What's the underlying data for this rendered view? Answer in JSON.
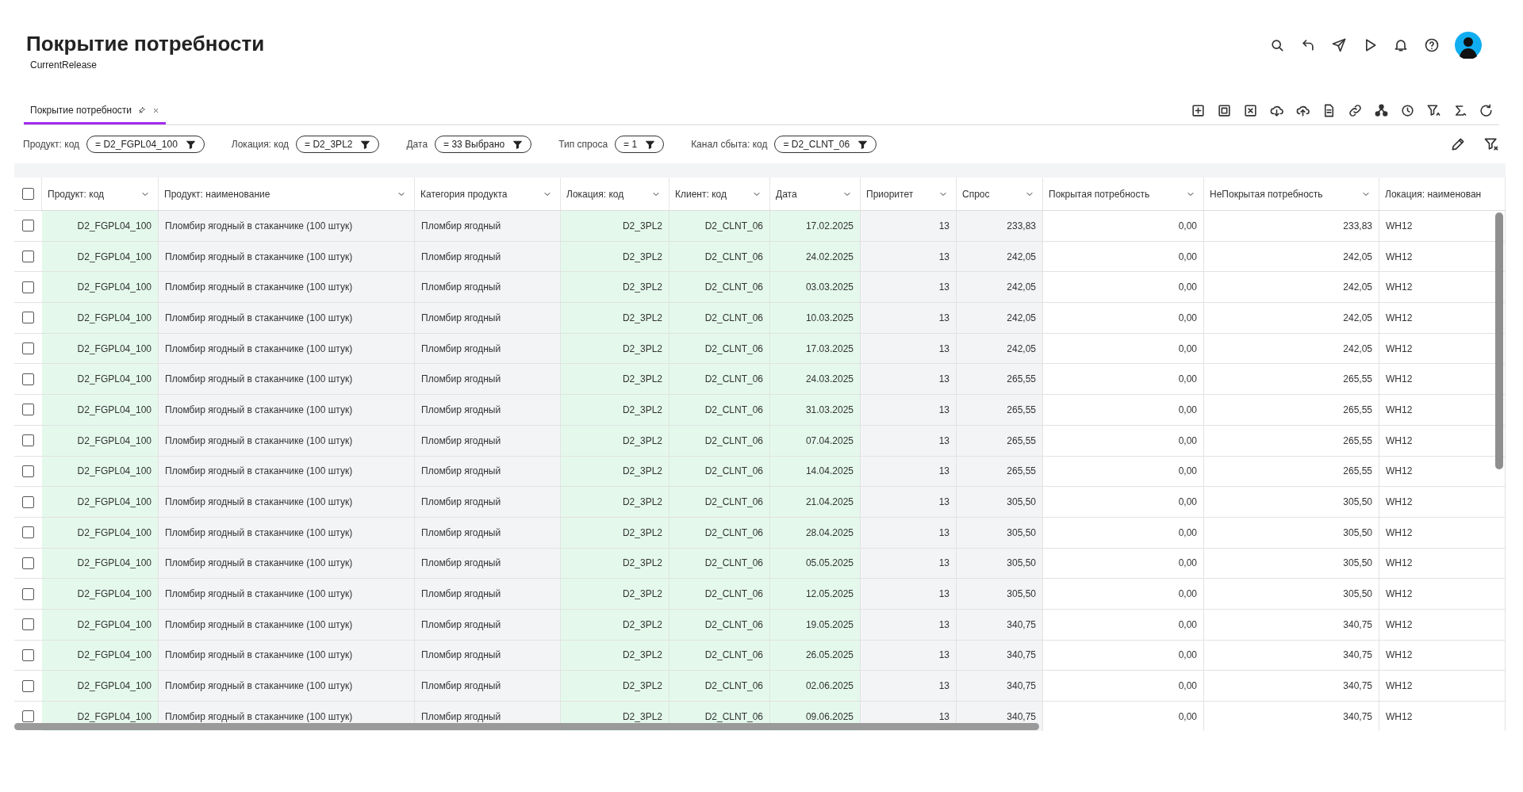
{
  "page": {
    "title": "Покрытие потребности",
    "subtitle": "CurrentRelease"
  },
  "tabs": [
    {
      "label": "Покрытие потребности",
      "selected": true
    }
  ],
  "filters": [
    {
      "label": "Продукт: код",
      "value": "= D2_FGPL04_100"
    },
    {
      "label": "Локация: код",
      "value": "= D2_3PL2"
    },
    {
      "label": "Дата",
      "value": "= 33 Выбрано"
    },
    {
      "label": "Тип спроса",
      "value": "= 1"
    },
    {
      "label": "Канал сбыта: код",
      "value": "= D2_CLNT_06"
    }
  ],
  "table": {
    "header_checked": false,
    "columns": [
      "Продукт: код",
      "Продукт: наименование",
      "Категория продукта",
      "Локация: код",
      "Клиент: код",
      "Дата",
      "Приоритет",
      "Спрос",
      "Покрытая потребность",
      "НеПокрытая потребность",
      "Локация: наименован"
    ],
    "rows": [
      {
        "checked": false,
        "cells": [
          "D2_FGPL04_100",
          "Пломбир ягодный в стаканчике (100 штук)",
          "Пломбир ягодный",
          "D2_3PL2",
          "D2_CLNT_06",
          "17.02.2025",
          "13",
          "233,83",
          "0,00",
          "233,83",
          "WH12"
        ]
      },
      {
        "checked": false,
        "cells": [
          "D2_FGPL04_100",
          "Пломбир ягодный в стаканчике (100 штук)",
          "Пломбир ягодный",
          "D2_3PL2",
          "D2_CLNT_06",
          "24.02.2025",
          "13",
          "242,05",
          "0,00",
          "242,05",
          "WH12"
        ]
      },
      {
        "checked": false,
        "cells": [
          "D2_FGPL04_100",
          "Пломбир ягодный в стаканчике (100 штук)",
          "Пломбир ягодный",
          "D2_3PL2",
          "D2_CLNT_06",
          "03.03.2025",
          "13",
          "242,05",
          "0,00",
          "242,05",
          "WH12"
        ]
      },
      {
        "checked": false,
        "cells": [
          "D2_FGPL04_100",
          "Пломбир ягодный в стаканчике (100 штук)",
          "Пломбир ягодный",
          "D2_3PL2",
          "D2_CLNT_06",
          "10.03.2025",
          "13",
          "242,05",
          "0,00",
          "242,05",
          "WH12"
        ]
      },
      {
        "checked": false,
        "cells": [
          "D2_FGPL04_100",
          "Пломбир ягодный в стаканчике (100 штук)",
          "Пломбир ягодный",
          "D2_3PL2",
          "D2_CLNT_06",
          "17.03.2025",
          "13",
          "242,05",
          "0,00",
          "242,05",
          "WH12"
        ]
      },
      {
        "checked": false,
        "cells": [
          "D2_FGPL04_100",
          "Пломбир ягодный в стаканчике (100 штук)",
          "Пломбир ягодный",
          "D2_3PL2",
          "D2_CLNT_06",
          "24.03.2025",
          "13",
          "265,55",
          "0,00",
          "265,55",
          "WH12"
        ]
      },
      {
        "checked": false,
        "cells": [
          "D2_FGPL04_100",
          "Пломбир ягодный в стаканчике (100 штук)",
          "Пломбир ягодный",
          "D2_3PL2",
          "D2_CLNT_06",
          "31.03.2025",
          "13",
          "265,55",
          "0,00",
          "265,55",
          "WH12"
        ]
      },
      {
        "checked": false,
        "cells": [
          "D2_FGPL04_100",
          "Пломбир ягодный в стаканчике (100 штук)",
          "Пломбир ягодный",
          "D2_3PL2",
          "D2_CLNT_06",
          "07.04.2025",
          "13",
          "265,55",
          "0,00",
          "265,55",
          "WH12"
        ]
      },
      {
        "checked": false,
        "cells": [
          "D2_FGPL04_100",
          "Пломбир ягодный в стаканчике (100 штук)",
          "Пломбир ягодный",
          "D2_3PL2",
          "D2_CLNT_06",
          "14.04.2025",
          "13",
          "265,55",
          "0,00",
          "265,55",
          "WH12"
        ]
      },
      {
        "checked": false,
        "cells": [
          "D2_FGPL04_100",
          "Пломбир ягодный в стаканчике (100 штук)",
          "Пломбир ягодный",
          "D2_3PL2",
          "D2_CLNT_06",
          "21.04.2025",
          "13",
          "305,50",
          "0,00",
          "305,50",
          "WH12"
        ]
      },
      {
        "checked": false,
        "cells": [
          "D2_FGPL04_100",
          "Пломбир ягодный в стаканчике (100 штук)",
          "Пломбир ягодный",
          "D2_3PL2",
          "D2_CLNT_06",
          "28.04.2025",
          "13",
          "305,50",
          "0,00",
          "305,50",
          "WH12"
        ]
      },
      {
        "checked": false,
        "cells": [
          "D2_FGPL04_100",
          "Пломбир ягодный в стаканчике (100 штук)",
          "Пломбир ягодный",
          "D2_3PL2",
          "D2_CLNT_06",
          "05.05.2025",
          "13",
          "305,50",
          "0,00",
          "305,50",
          "WH12"
        ]
      },
      {
        "checked": false,
        "cells": [
          "D2_FGPL04_100",
          "Пломбир ягодный в стаканчике (100 штук)",
          "Пломбир ягодный",
          "D2_3PL2",
          "D2_CLNT_06",
          "12.05.2025",
          "13",
          "305,50",
          "0,00",
          "305,50",
          "WH12"
        ]
      },
      {
        "checked": false,
        "cells": [
          "D2_FGPL04_100",
          "Пломбир ягодный в стаканчике (100 штук)",
          "Пломбир ягодный",
          "D2_3PL2",
          "D2_CLNT_06",
          "19.05.2025",
          "13",
          "340,75",
          "0,00",
          "340,75",
          "WH12"
        ]
      },
      {
        "checked": false,
        "cells": [
          "D2_FGPL04_100",
          "Пломбир ягодный в стаканчике (100 штук)",
          "Пломбир ягодный",
          "D2_3PL2",
          "D2_CLNT_06",
          "26.05.2025",
          "13",
          "340,75",
          "0,00",
          "340,75",
          "WH12"
        ]
      },
      {
        "checked": false,
        "cells": [
          "D2_FGPL04_100",
          "Пломбир ягодный в стаканчике (100 штук)",
          "Пломбир ягодный",
          "D2_3PL2",
          "D2_CLNT_06",
          "02.06.2025",
          "13",
          "340,75",
          "0,00",
          "340,75",
          "WH12"
        ]
      },
      {
        "checked": false,
        "cells": [
          "D2_FGPL04_100",
          "Пломбир ягодный в стаканчике (100 штук)",
          "Пломбир ягодный",
          "D2_3PL2",
          "D2_CLNT_06",
          "09.06.2025",
          "13",
          "340,75",
          "0,00",
          "340,75",
          "WH12"
        ]
      }
    ]
  }
}
